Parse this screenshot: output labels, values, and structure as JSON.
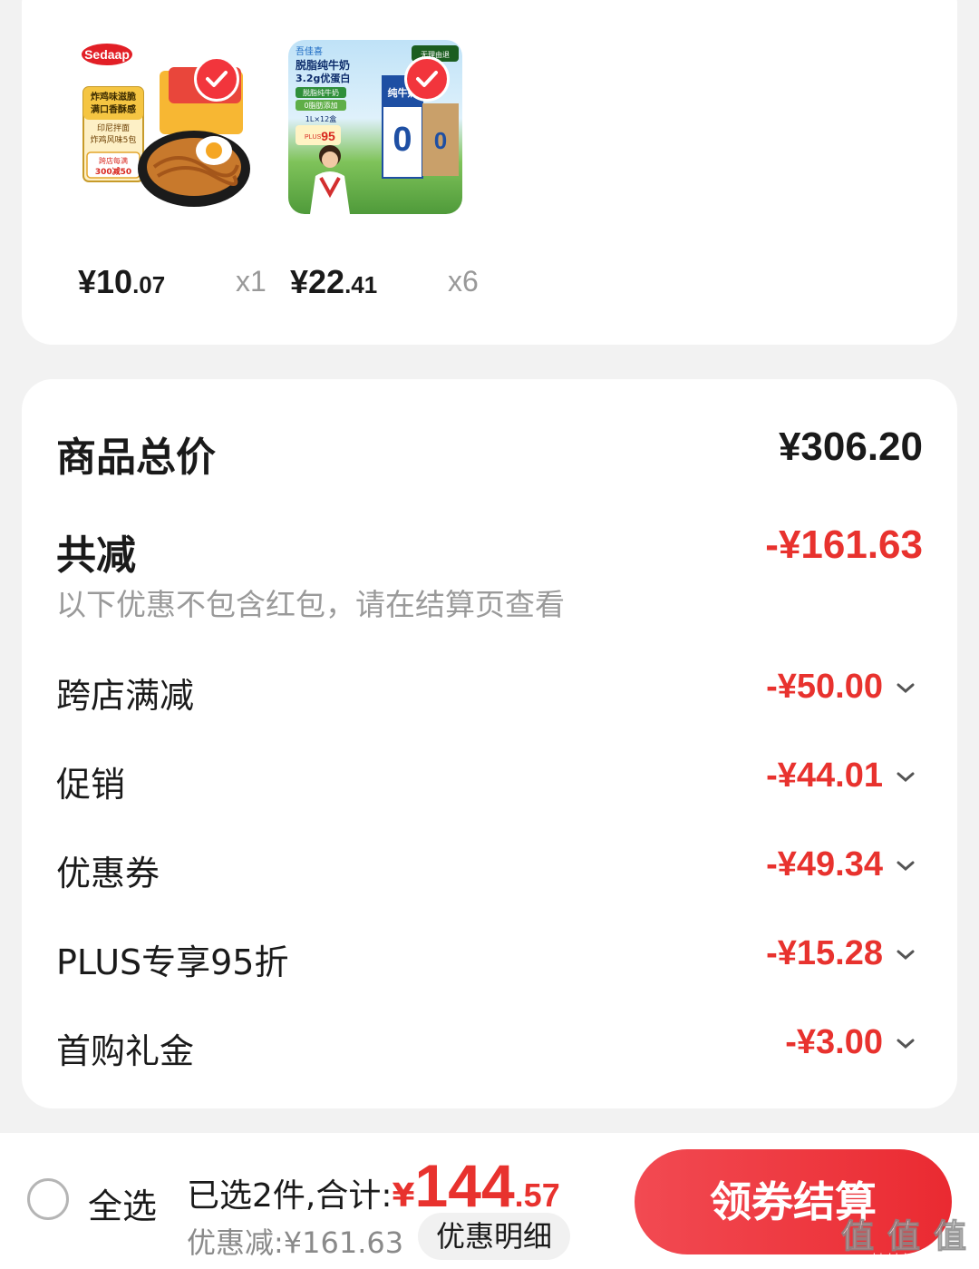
{
  "products": [
    {
      "name": "印尼拌面炸鸡风味",
      "image_texts": [
        "Sedaap",
        "炸鸡味滋脆",
        "满口香酥感",
        "印尼拌面",
        "炸鸡风味5包",
        "跨店每满",
        "300减50"
      ],
      "price_int": "¥10",
      "price_dec": ".07",
      "qty": "x1",
      "selected": true
    },
    {
      "name": "脱脂纯牛奶",
      "image_texts": [
        "吾佳喜",
        "脱脂纯牛奶",
        "3.2g优蛋白",
        "脱脂纯牛奶",
        "0脂肪添加",
        "1L×12盒",
        "PLUS",
        "95",
        "纯牛奶",
        "0",
        "无理由退"
      ],
      "price_int": "¥22",
      "price_dec": ".41",
      "qty": "x6",
      "selected": true
    }
  ],
  "summary": {
    "total_label": "商品总价",
    "total_value": "¥306.20",
    "reduce_label": "共减",
    "reduce_value": "-¥161.63",
    "note": "以下优惠不包含红包，请在结算页查看",
    "discounts": [
      {
        "label": "跨店满减",
        "value": "-¥50.00"
      },
      {
        "label": "促销",
        "value": "-¥44.01"
      },
      {
        "label": "优惠券",
        "value": "-¥49.34"
      },
      {
        "label": "PLUS专享95折",
        "value": "-¥15.28"
      },
      {
        "label": "首购礼金",
        "value": "-¥3.00"
      }
    ]
  },
  "bottom": {
    "select_all": "全选",
    "selected_text": "已选2件,合计:",
    "total_yen": "¥",
    "total_int": "144",
    "total_dec": ".57",
    "saved_text": "优惠减:¥161.63",
    "detail_button": "优惠明细",
    "checkout_button": "领券结算",
    "watermark": "值",
    "watermark_url": "zhizhizhi.com"
  },
  "colors": {
    "accent_red": "#e8322e",
    "button_red": "#f24a52",
    "background": "#f2f2f2",
    "muted_text": "#9a9a9a"
  }
}
